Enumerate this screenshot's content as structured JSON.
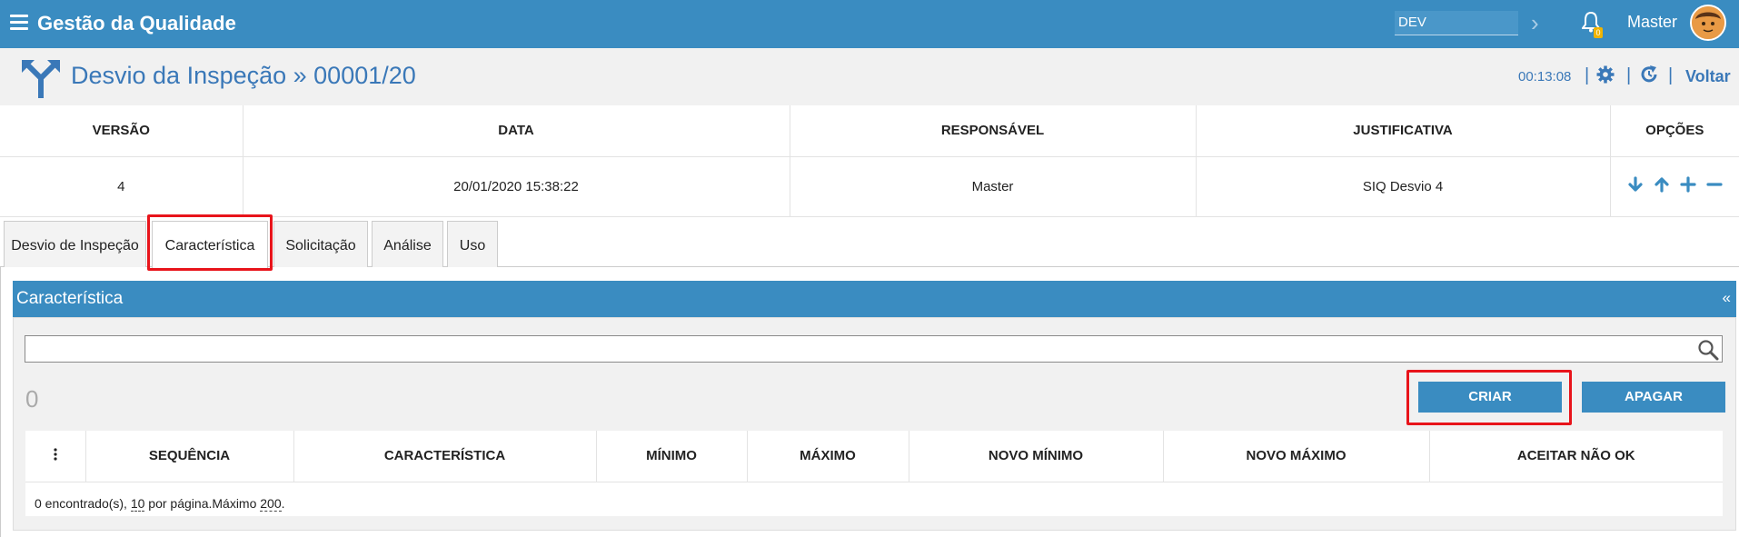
{
  "header": {
    "app_title": "Gestão da Qualidade",
    "environment": "DEV",
    "notification_count": "0",
    "user": "Master"
  },
  "title_bar": {
    "title": "Desvio da Inspeção » 00001/20",
    "timer": "00:13:08",
    "back_label": "Voltar"
  },
  "versions": {
    "columns": [
      "VERSÃO",
      "DATA",
      "RESPONSÁVEL",
      "JUSTIFICATIVA",
      "OPÇÕES"
    ],
    "row": {
      "versao": "4",
      "data": "20/01/2020 15:38:22",
      "responsavel": "Master",
      "justificativa": "SIQ Desvio 4"
    }
  },
  "tabs": [
    {
      "label": "Desvio de Inspeção",
      "active": false
    },
    {
      "label": "Característica",
      "active": true
    },
    {
      "label": "Solicitação",
      "active": false
    },
    {
      "label": "Análise",
      "active": false
    },
    {
      "label": "Uso",
      "active": false
    }
  ],
  "panel": {
    "title": "Característica",
    "collapse_glyph": "«",
    "search_placeholder": "",
    "record_count": "0",
    "create_label": "CRIAR",
    "delete_label": "APAGAR",
    "columns": [
      "SEQUÊNCIA",
      "CARACTERÍSTICA",
      "MÍNIMO",
      "MÁXIMO",
      "NOVO MÍNIMO",
      "NOVO MÁXIMO",
      "ACEITAR NÃO OK"
    ],
    "footer": {
      "found_text": "0 encontrado(s), ",
      "per_page": "10",
      "per_page_text": " por página.Máximo ",
      "max": "200",
      "end": "."
    }
  },
  "colors": {
    "primary": "#3a8cc1",
    "title_blue": "#3a78b8",
    "highlight": "#e8141b"
  }
}
